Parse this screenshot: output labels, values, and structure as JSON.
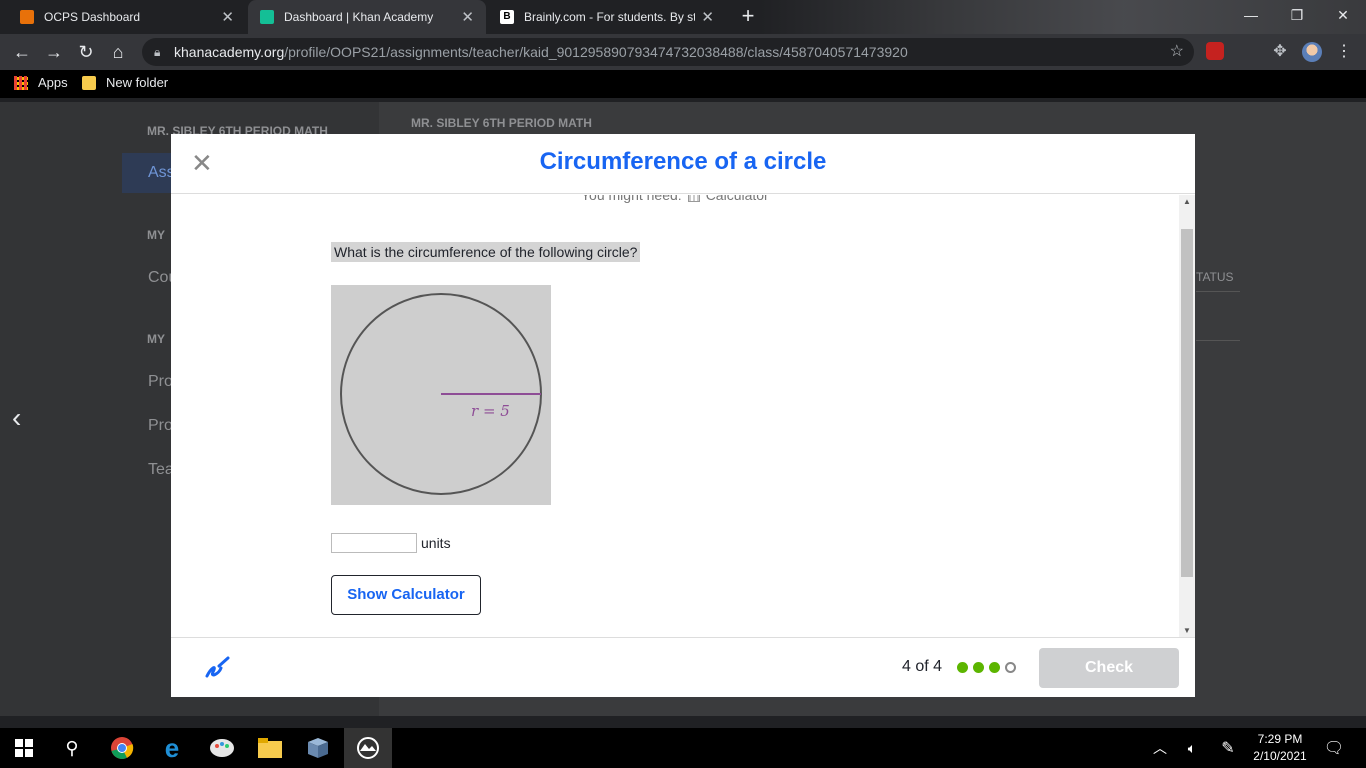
{
  "browser": {
    "tabs": [
      {
        "title": "OCPS Dashboard",
        "favicon_color": "#e8710a"
      },
      {
        "title": "Dashboard | Khan Academy",
        "favicon_color": "#14bf96"
      },
      {
        "title": "Brainly.com - For students. By stu",
        "favicon_color": "#ffffff"
      }
    ],
    "url_domain": "khanacademy.org",
    "url_path": "/profile/OOPS21/assignments/teacher/kaid_901295890793474732038488/class/4587040571473920",
    "bookmarks": [
      {
        "label": "Apps"
      },
      {
        "label": "New folder"
      }
    ]
  },
  "background_page": {
    "class_name_left": "MR. SIBLEY 6TH PERIOD MATH",
    "class_name_main": "MR. SIBLEY 6TH PERIOD MATH",
    "nav_assignments": "Ass",
    "section_my_1": "MY",
    "nav_courses": "Cou",
    "section_my_2": "MY",
    "nav_pro_1": "Pro",
    "nav_pro_2": "Pro",
    "nav_tea": "Tea",
    "col_status": "TATUS"
  },
  "modal": {
    "title": "Circumference of a circle",
    "might_need": "You might need:",
    "might_need_tool": "Calculator",
    "question": "What is the circumference of the following circle?",
    "figure_label": "r = 5",
    "answer_value": "",
    "answer_unit": "units",
    "show_calculator": "Show Calculator",
    "progress": "4 of 4",
    "dots": [
      "complete",
      "complete",
      "complete",
      "empty"
    ],
    "check_label": "Check"
  },
  "taskbar": {
    "time": "7:29 PM",
    "date": "2/10/2021"
  },
  "colors": {
    "accent": "#1865f2",
    "dot_complete": "#5cb500",
    "figure_radius": "#8e4d96"
  }
}
